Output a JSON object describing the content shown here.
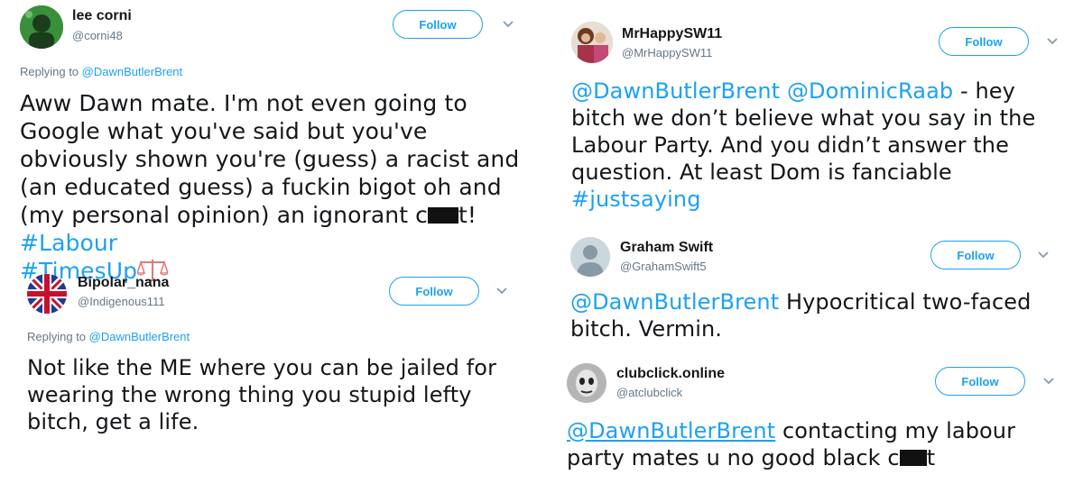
{
  "tweets": [
    {
      "name": "lee corni",
      "handle": "@corni48",
      "follow_label": "Follow",
      "replying_prefix": "Replying to",
      "replying_to": "@DawnButlerBrent",
      "text_part1": "Aww Dawn mate. I'm not even going to Google what you've said but you've obviously shown you're (guess) a racist and (an educated guess) a fuckin bigot oh and (my personal opinion) an ignorant c",
      "text_part2": "t!  ",
      "hashtag1": "#Labour",
      "hashtag2": "#TimesUp",
      "emoji": "scales-icon"
    },
    {
      "name": "Bipolar_nana",
      "handle": "@Indigenous111",
      "follow_label": "Follow",
      "replying_prefix": "Replying to",
      "replying_to": "@DawnButlerBrent",
      "text": "Not like the ME where you can be jailed for wearing the wrong thing you stupid lefty bitch, get a life."
    },
    {
      "name": "MrHappySW11",
      "handle": "@MrHappySW11",
      "follow_label": "Follow",
      "mention1": "@DawnButlerBrent",
      "mention2": "@DominicRaab",
      "text": "  - hey bitch we don’t believe what you say in the Labour Party. And you didn’t answer the question. At least Dom is fanciable",
      "hashtag": "#justsaying"
    },
    {
      "name": "Graham Swift",
      "handle": "@GrahamSwift5",
      "follow_label": "Follow",
      "mention": "@DawnButlerBrent",
      "text": " Hypocritical two-faced bitch. Vermin."
    },
    {
      "name": "clubclick.online",
      "handle": "@atclubclick",
      "follow_label": "Follow",
      "mention": "@DawnButlerBrent",
      "text_part1": " contacting my labour party mates u no good black c",
      "text_part2": "t"
    }
  ],
  "colors": {
    "accent": "#1da1f2",
    "text": "#14171a",
    "muted": "#657786"
  }
}
